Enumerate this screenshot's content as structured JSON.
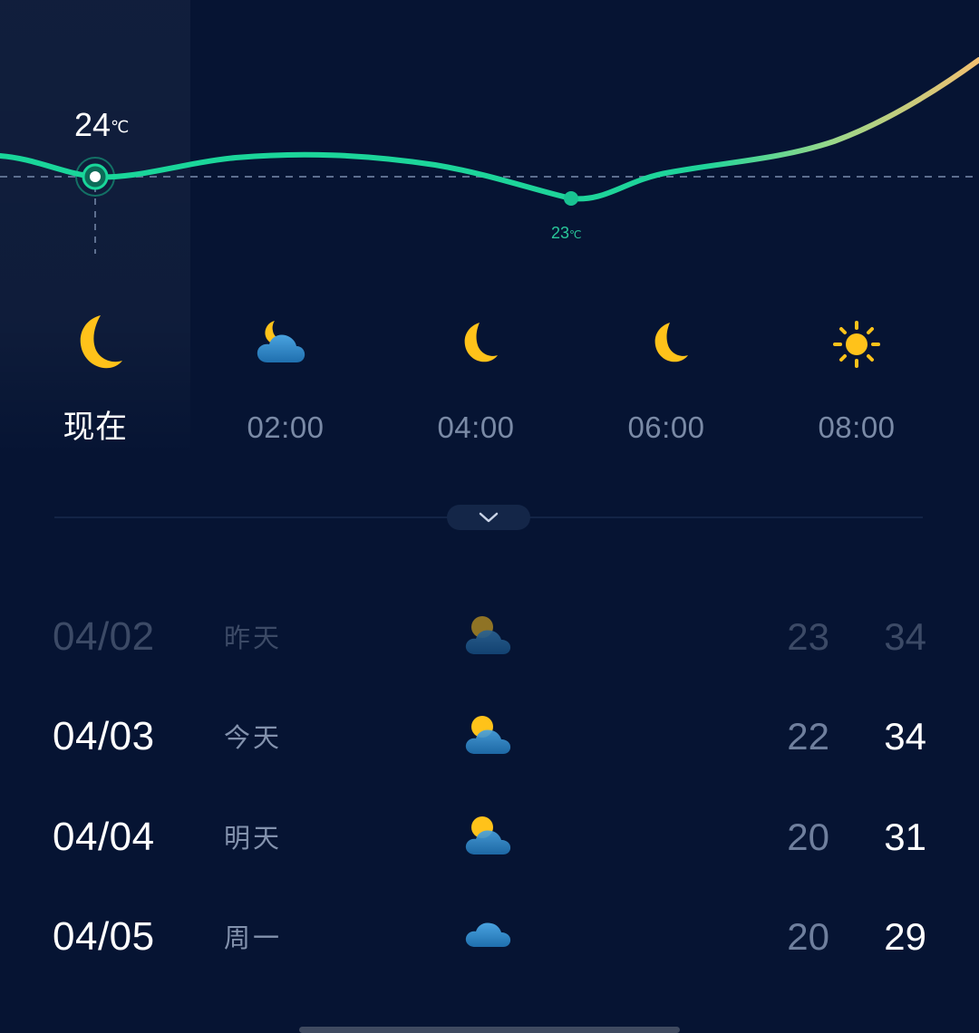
{
  "hourly": {
    "current_temp": "24",
    "current_unit": "℃",
    "min_temp": "23",
    "min_unit": "℃",
    "columns": [
      {
        "label": "现在",
        "icon": "moon-icon"
      },
      {
        "label": "02:00",
        "icon": "moon-cloud-icon"
      },
      {
        "label": "04:00",
        "icon": "moon-icon"
      },
      {
        "label": "06:00",
        "icon": "moon-icon"
      },
      {
        "label": "08:00",
        "icon": "sun-icon"
      }
    ]
  },
  "daily": [
    {
      "date": "04/02",
      "day": "昨天",
      "icon": "partly-cloudy-icon",
      "low": "23",
      "high": "34",
      "past": true
    },
    {
      "date": "04/03",
      "day": "今天",
      "icon": "partly-cloudy-icon",
      "low": "22",
      "high": "34",
      "past": false
    },
    {
      "date": "04/04",
      "day": "明天",
      "icon": "partly-cloudy-icon",
      "low": "20",
      "high": "31",
      "past": false
    },
    {
      "date": "04/05",
      "day": "周一",
      "icon": "cloud-icon",
      "low": "20",
      "high": "29",
      "past": false
    }
  ],
  "colors": {
    "background": "#061433",
    "curve_start": "#19d69a",
    "curve_end": "#f0c070",
    "sun": "#ffc21a",
    "cloud": "#3b8fd0"
  }
}
